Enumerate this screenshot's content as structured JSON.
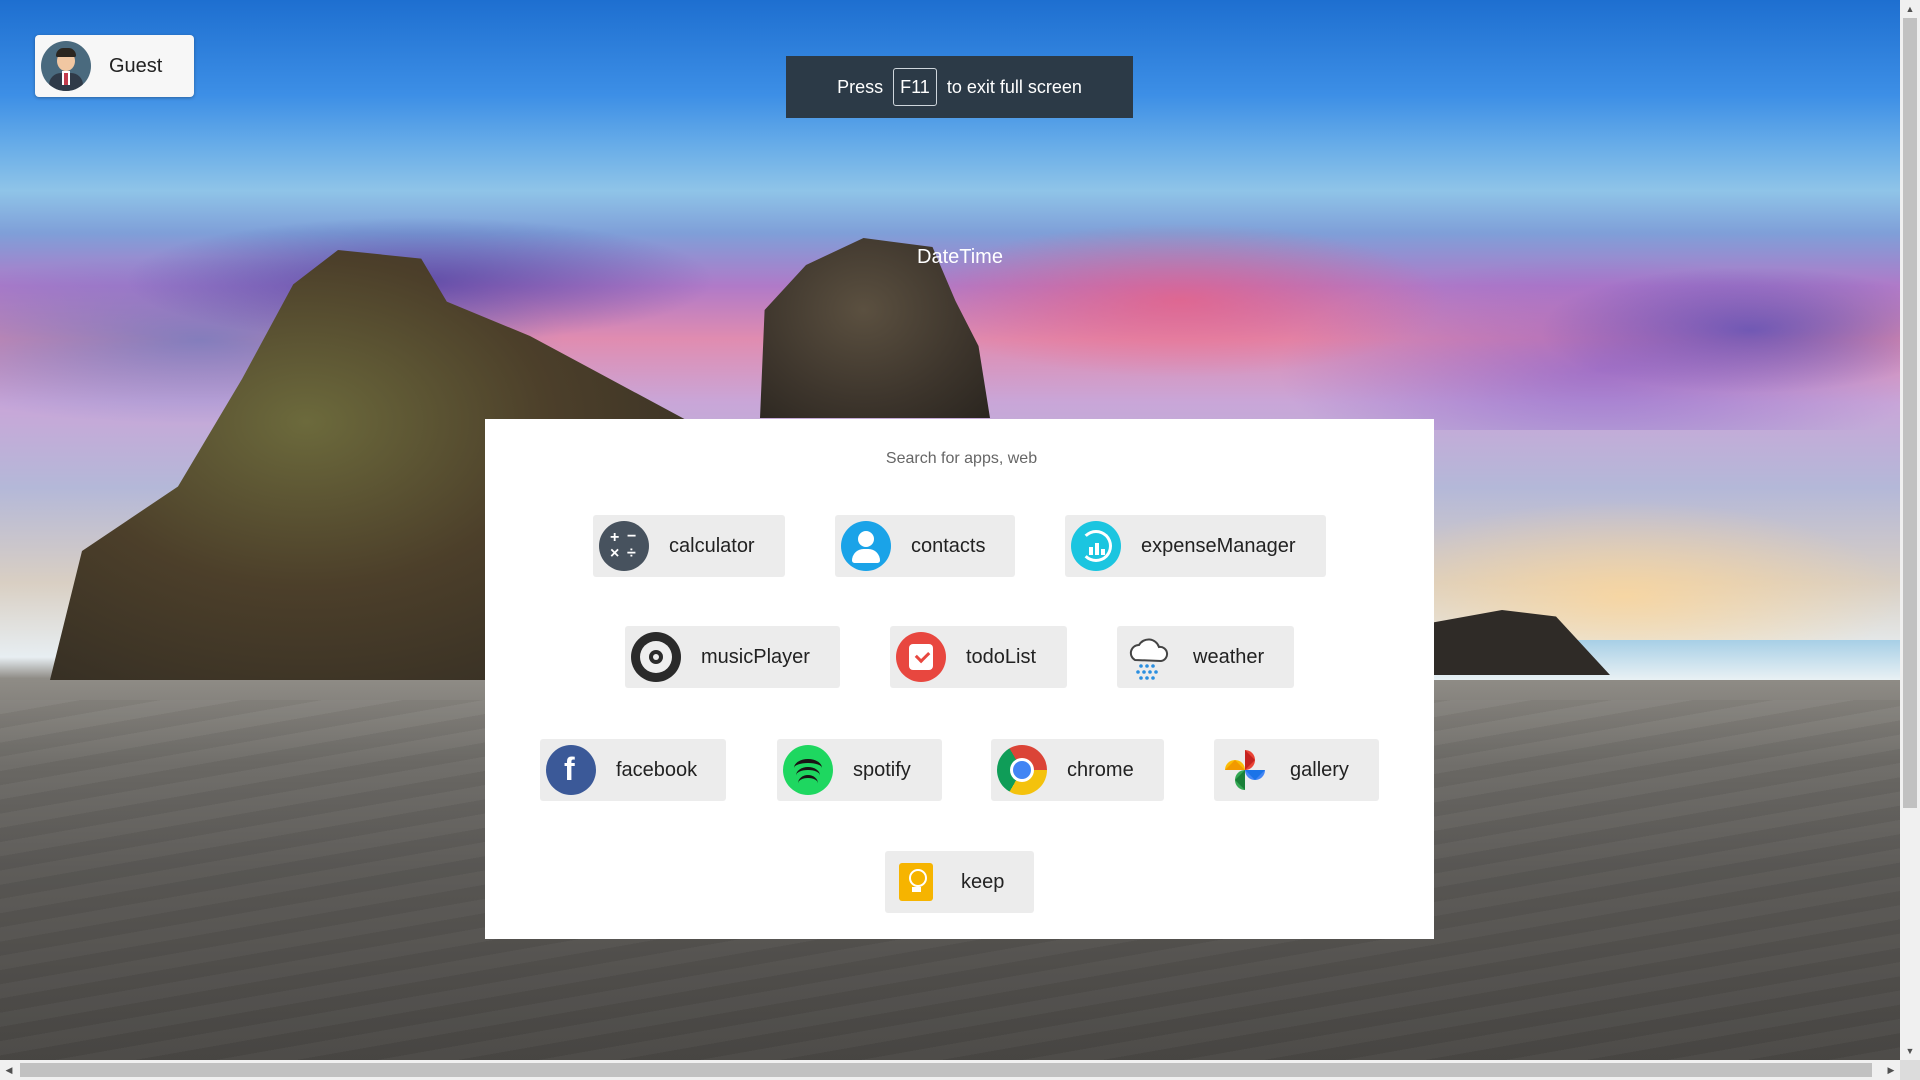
{
  "user": {
    "name": "Guest"
  },
  "fullscreen_notice": {
    "prefix": "Press",
    "key": "F11",
    "suffix": "to exit full screen"
  },
  "datetime": "DateTime",
  "search": {
    "placeholder": "Search for apps, web",
    "value": ""
  },
  "apps": [
    {
      "label": "calculator",
      "icon": "calculator-icon"
    },
    {
      "label": "contacts",
      "icon": "contacts-icon"
    },
    {
      "label": "expenseManager",
      "icon": "expense-manager-icon"
    },
    {
      "label": "musicPlayer",
      "icon": "music-player-icon"
    },
    {
      "label": "todoList",
      "icon": "todo-list-icon"
    },
    {
      "label": "weather",
      "icon": "weather-icon"
    },
    {
      "label": "facebook",
      "icon": "facebook-icon"
    },
    {
      "label": "spotify",
      "icon": "spotify-icon"
    },
    {
      "label": "chrome",
      "icon": "chrome-icon"
    },
    {
      "label": "gallery",
      "icon": "gallery-icon"
    },
    {
      "label": "keep",
      "icon": "keep-icon"
    }
  ],
  "colors": {
    "panel_bg": "#ffffff",
    "app_tile_bg": "#ececec",
    "notice_bg": "#2c3a47"
  }
}
